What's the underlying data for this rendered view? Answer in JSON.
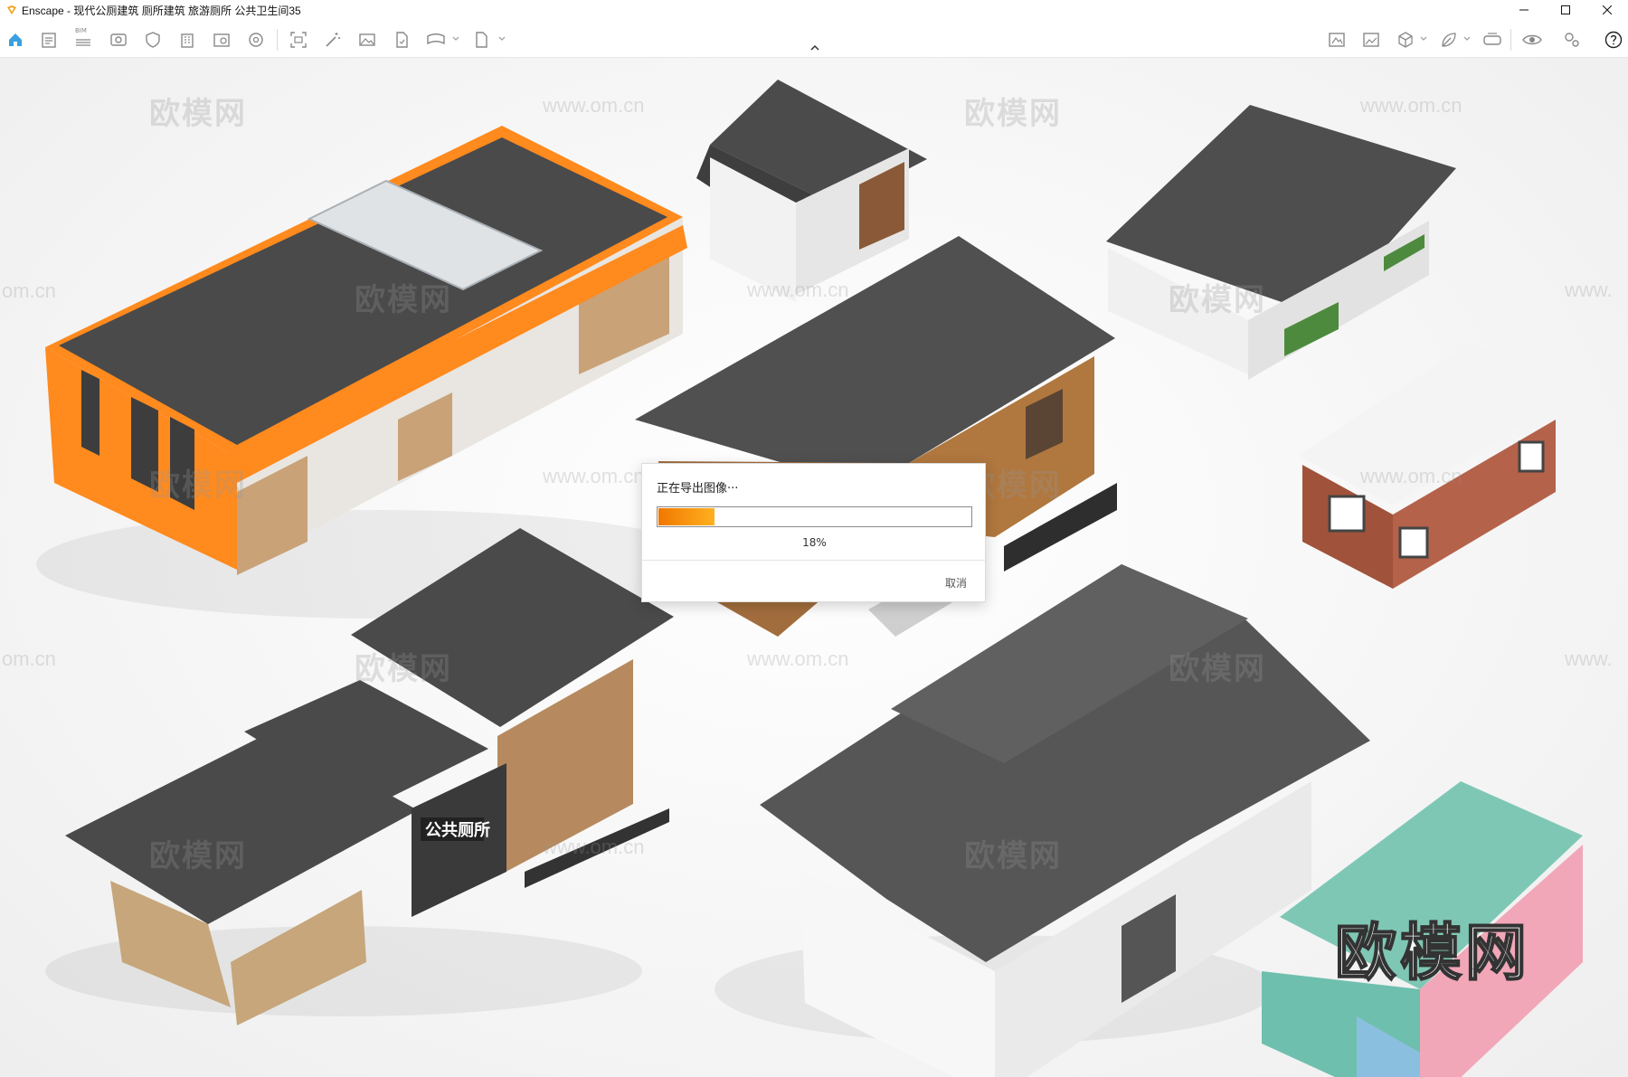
{
  "app": {
    "title": "Enscape - 现代公厕建筑 厕所建筑 旅游厕所 公共卫生间35",
    "accent": "#f4a21b"
  },
  "window_controls": [
    {
      "name": "minimize-button",
      "icon": "minimize-icon"
    },
    {
      "name": "maximize-button",
      "icon": "maximize-icon"
    },
    {
      "name": "close-button",
      "icon": "close-icon"
    }
  ],
  "toolbar": {
    "bim_label": "BIM",
    "left_tools": [
      "home-icon",
      "document-icon",
      "bim-icon",
      "view-icon",
      "shield-icon",
      "building-icon",
      "render-icon",
      "gear-wheel-icon",
      "screenshot-icon",
      "magic-wand-icon",
      "image-icon",
      "export-file-icon",
      "panorama-icon",
      "batch-export-icon"
    ],
    "right_tools": [
      "asset-library-icon",
      "image-settings-icon",
      "cube-icon",
      "leaf-icon",
      "vr-headset-icon",
      "eye-icon",
      "settings-icon",
      "help-icon"
    ]
  },
  "viewport": {
    "watermark_cn": "欧模网",
    "watermark_url": "www.om.cn",
    "watermark_url_partial": "om.cn",
    "watermark_url_edge": "www.",
    "building_sign": "公共厕所"
  },
  "export_dialog": {
    "message": "正在导出图像···",
    "progress": 0.18,
    "progress_text": "18%",
    "cancel_label": "取消",
    "progress_color": "#f07800"
  }
}
